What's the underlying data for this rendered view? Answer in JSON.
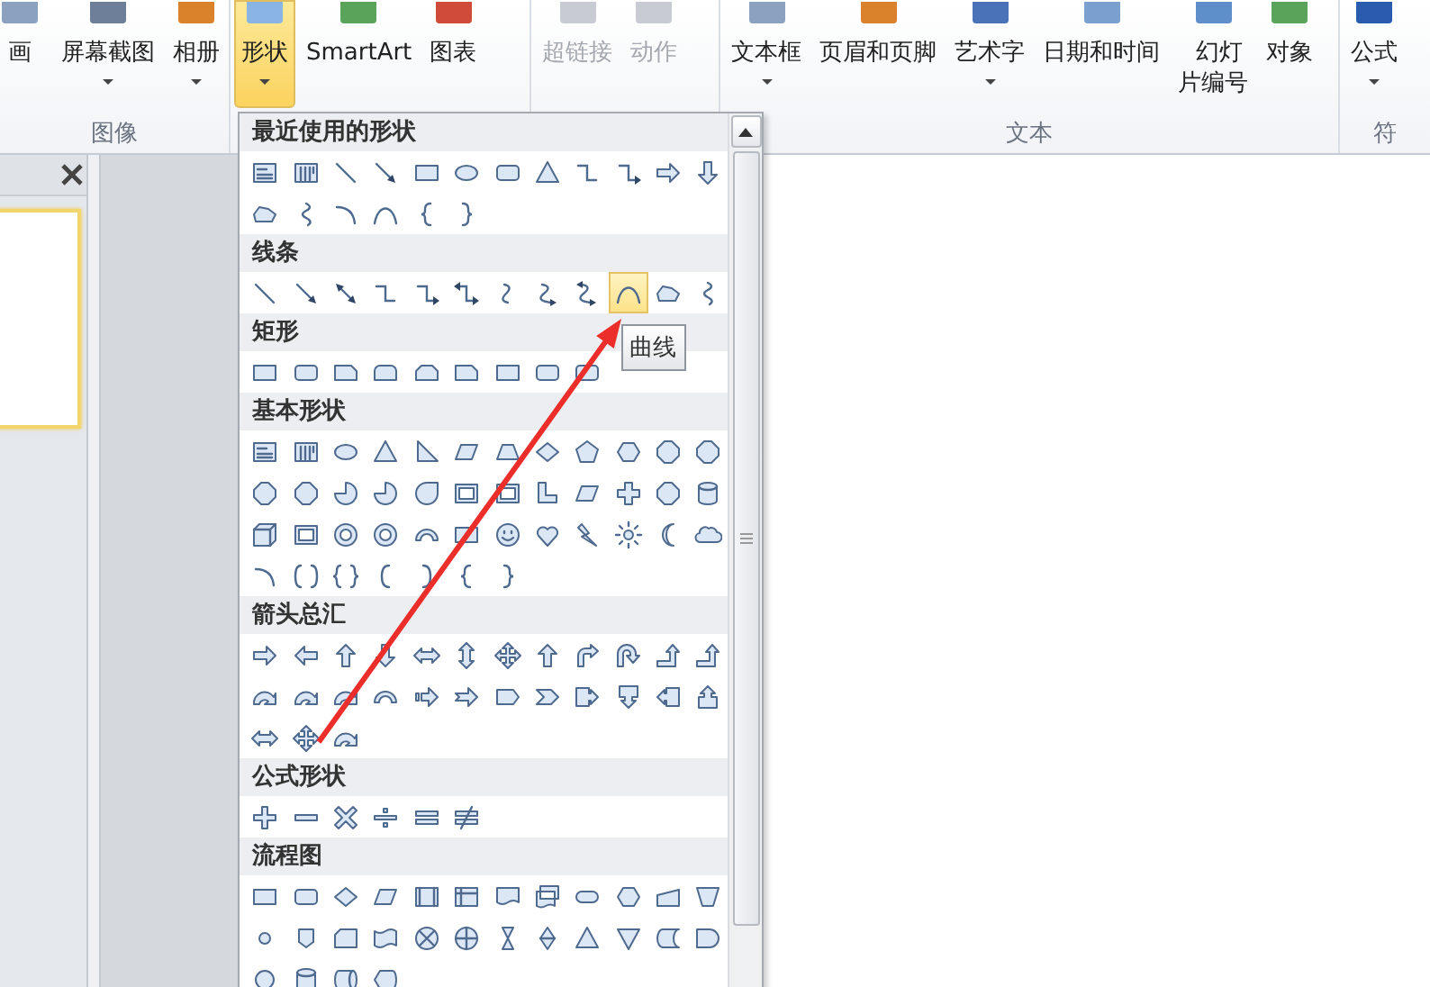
{
  "ribbon": {
    "groups": [
      {
        "label": "图像",
        "buttons": [
          {
            "label": "画",
            "dropdown": false,
            "disabled": false,
            "selected": false
          },
          {
            "label": "屏幕截图",
            "dropdown": true,
            "disabled": false,
            "selected": false
          },
          {
            "label": "相册",
            "dropdown": true,
            "disabled": false,
            "selected": false
          }
        ]
      },
      {
        "buttons": [
          {
            "label": "形状",
            "dropdown": true,
            "disabled": false,
            "selected": true
          },
          {
            "label": "SmartArt",
            "dropdown": false,
            "disabled": false,
            "selected": false
          },
          {
            "label": "图表",
            "dropdown": false,
            "disabled": false,
            "selected": false
          }
        ]
      },
      {
        "buttons": [
          {
            "label": "超链接",
            "dropdown": false,
            "disabled": true,
            "selected": false
          },
          {
            "label": "动作",
            "dropdown": false,
            "disabled": true,
            "selected": false
          }
        ]
      },
      {
        "label": "文本",
        "buttons": [
          {
            "label": "文本框",
            "dropdown": true,
            "disabled": false,
            "selected": false
          },
          {
            "label": "页眉和页脚",
            "dropdown": false,
            "disabled": false,
            "selected": false
          },
          {
            "label": "艺术字",
            "dropdown": true,
            "disabled": false,
            "selected": false
          },
          {
            "label": "日期和时间",
            "dropdown": false,
            "disabled": false,
            "selected": false
          },
          {
            "label": "幻灯片编号",
            "two_line": true,
            "dropdown": false,
            "disabled": false,
            "selected": false
          },
          {
            "label": "对象",
            "dropdown": false,
            "disabled": false,
            "selected": false
          }
        ]
      },
      {
        "label": "符",
        "buttons": [
          {
            "label": "公式",
            "dropdown": true,
            "disabled": false,
            "selected": false
          }
        ]
      }
    ]
  },
  "shapes_gallery": {
    "sections": [
      {
        "title": "最近使用的形状",
        "items": [
          {
            "kind": "textbox",
            "selected": false
          },
          {
            "kind": "vtextbox",
            "selected": false
          },
          {
            "kind": "line",
            "selected": false
          },
          {
            "kind": "arrow-line",
            "selected": false
          },
          {
            "kind": "rect",
            "selected": false
          },
          {
            "kind": "oval",
            "selected": false
          },
          {
            "kind": "roundrect",
            "selected": false
          },
          {
            "kind": "triangle",
            "selected": false
          },
          {
            "kind": "elbow",
            "selected": false
          },
          {
            "kind": "elbow-arrow",
            "selected": false
          },
          {
            "kind": "arrow-right",
            "selected": false
          },
          {
            "kind": "arrow-down",
            "selected": false
          },
          {
            "kind": "freeform",
            "selected": false
          },
          {
            "kind": "scribble",
            "selected": false
          },
          {
            "kind": "arc",
            "selected": false
          },
          {
            "kind": "curve",
            "selected": false
          },
          {
            "kind": "brace-left",
            "selected": false
          },
          {
            "kind": "brace-right",
            "selected": false
          }
        ]
      },
      {
        "title": "线条",
        "items": [
          {
            "kind": "line",
            "selected": false
          },
          {
            "kind": "arrow-line",
            "selected": false
          },
          {
            "kind": "double-arrow-line",
            "selected": false
          },
          {
            "kind": "elbow",
            "selected": false
          },
          {
            "kind": "elbow-arrow",
            "selected": false
          },
          {
            "kind": "elbow-double-arrow",
            "selected": false
          },
          {
            "kind": "curved-connector",
            "selected": false
          },
          {
            "kind": "curved-arrow-connector",
            "selected": false
          },
          {
            "kind": "curved-double-arrow",
            "selected": false
          },
          {
            "kind": "curve",
            "selected": true,
            "tooltip": "曲线"
          },
          {
            "kind": "freeform",
            "selected": false
          },
          {
            "kind": "scribble",
            "selected": false
          }
        ]
      },
      {
        "title": "矩形",
        "items": [
          {
            "kind": "rect",
            "selected": false
          },
          {
            "kind": "roundrect",
            "selected": false
          },
          {
            "kind": "snip",
            "selected": false
          },
          {
            "kind": "roundtop",
            "selected": false
          },
          {
            "kind": "snip-two",
            "selected": false
          },
          {
            "kind": "snip",
            "selected": false
          },
          {
            "kind": "rect",
            "selected": false
          },
          {
            "kind": "roundrect",
            "selected": false
          },
          {
            "kind": "roundrect",
            "selected": false
          }
        ]
      },
      {
        "title": "基本形状",
        "items": [
          {
            "kind": "textbox",
            "selected": false
          },
          {
            "kind": "vtextbox",
            "selected": false
          },
          {
            "kind": "oval",
            "selected": false
          },
          {
            "kind": "triangle",
            "selected": false
          },
          {
            "kind": "right-triangle",
            "selected": false
          },
          {
            "kind": "parallelogram",
            "selected": false
          },
          {
            "kind": "trapezoid",
            "selected": false
          },
          {
            "kind": "diamond",
            "selected": false
          },
          {
            "kind": "pentagon",
            "selected": false
          },
          {
            "kind": "hexagon",
            "selected": false
          },
          {
            "kind": "octagon",
            "selected": false
          },
          {
            "kind": "octagon",
            "selected": false
          },
          {
            "kind": "octagon",
            "selected": false
          },
          {
            "kind": "octagon",
            "selected": false
          },
          {
            "kind": "pie",
            "selected": false
          },
          {
            "kind": "pie",
            "selected": false
          },
          {
            "kind": "teardrop",
            "selected": false
          },
          {
            "kind": "frame",
            "selected": false
          },
          {
            "kind": "frame",
            "selected": false
          },
          {
            "kind": "lshape",
            "selected": false
          },
          {
            "kind": "parallelogram",
            "selected": false
          },
          {
            "kind": "cross",
            "selected": false
          },
          {
            "kind": "octagon",
            "selected": false
          },
          {
            "kind": "can",
            "selected": false
          },
          {
            "kind": "cube",
            "selected": false
          },
          {
            "kind": "frame",
            "selected": false
          },
          {
            "kind": "donut",
            "selected": false
          },
          {
            "kind": "donut",
            "selected": false
          },
          {
            "kind": "block-arc",
            "selected": false
          },
          {
            "kind": "rect",
            "selected": false
          },
          {
            "kind": "smiley",
            "selected": false
          },
          {
            "kind": "heart",
            "selected": false
          },
          {
            "kind": "lightning",
            "selected": false
          },
          {
            "kind": "sun",
            "selected": false
          },
          {
            "kind": "moon",
            "selected": false
          },
          {
            "kind": "cloud",
            "selected": false
          },
          {
            "kind": "arc",
            "selected": false
          },
          {
            "kind": "bracket-pair",
            "selected": false
          },
          {
            "kind": "brace-pair",
            "selected": false
          },
          {
            "kind": "bracket-left",
            "selected": false
          },
          {
            "kind": "bracket-right",
            "selected": false
          },
          {
            "kind": "brace-left",
            "selected": false
          },
          {
            "kind": "brace-right",
            "selected": false
          }
        ]
      },
      {
        "title": "箭头总汇",
        "items": [
          {
            "kind": "arrow-right",
            "selected": false
          },
          {
            "kind": "arrow-left",
            "selected": false
          },
          {
            "kind": "arrow-up",
            "selected": false
          },
          {
            "kind": "arrow-down",
            "selected": false
          },
          {
            "kind": "arrow-left-right",
            "selected": false
          },
          {
            "kind": "arrow-up-down",
            "selected": false
          },
          {
            "kind": "quad-arrow",
            "selected": false
          },
          {
            "kind": "arrow-up",
            "selected": false
          },
          {
            "kind": "bent-arrow",
            "selected": false
          },
          {
            "kind": "uturn-arrow",
            "selected": false
          },
          {
            "kind": "bent-up-arrow",
            "selected": false
          },
          {
            "kind": "bent-up-arrow",
            "selected": false
          },
          {
            "kind": "circular-arrow",
            "selected": false
          },
          {
            "kind": "circular-arrow",
            "selected": false
          },
          {
            "kind": "circular-arrow",
            "selected": false
          },
          {
            "kind": "block-arc",
            "selected": false
          },
          {
            "kind": "striped-arrow",
            "selected": false
          },
          {
            "kind": "notched-arrow",
            "selected": false
          },
          {
            "kind": "homeplate",
            "selected": false
          },
          {
            "kind": "chevron",
            "selected": false
          },
          {
            "kind": "callout-right",
            "selected": false
          },
          {
            "kind": "callout-down",
            "selected": false
          },
          {
            "kind": "callout-left",
            "selected": false
          },
          {
            "kind": "callout-up",
            "selected": false
          },
          {
            "kind": "arrow-left-right",
            "selected": false
          },
          {
            "kind": "quad-arrow",
            "selected": false
          },
          {
            "kind": "circular-arrow",
            "selected": false
          }
        ]
      },
      {
        "title": "公式形状",
        "items": [
          {
            "kind": "plus",
            "selected": false
          },
          {
            "kind": "minus",
            "selected": false
          },
          {
            "kind": "multiply",
            "selected": false
          },
          {
            "kind": "divide",
            "selected": false
          },
          {
            "kind": "equal",
            "selected": false
          },
          {
            "kind": "not-equal",
            "selected": false
          }
        ]
      },
      {
        "title": "流程图",
        "items": [
          {
            "kind": "rect",
            "selected": false
          },
          {
            "kind": "roundrect",
            "selected": false
          },
          {
            "kind": "diamond",
            "selected": false
          },
          {
            "kind": "parallelogram",
            "selected": false
          },
          {
            "kind": "predefined",
            "selected": false
          },
          {
            "kind": "internal-storage",
            "selected": false
          },
          {
            "kind": "document",
            "selected": false
          },
          {
            "kind": "multidocument",
            "selected": false
          },
          {
            "kind": "terminator",
            "selected": false
          },
          {
            "kind": "hexagon",
            "selected": false
          },
          {
            "kind": "manual-input",
            "selected": false
          },
          {
            "kind": "manual-operation",
            "selected": false
          },
          {
            "kind": "small-circle",
            "selected": false
          },
          {
            "kind": "offpage",
            "selected": false
          },
          {
            "kind": "card",
            "selected": false
          },
          {
            "kind": "punched-tape",
            "selected": false
          },
          {
            "kind": "summing",
            "selected": false
          },
          {
            "kind": "or",
            "selected": false
          },
          {
            "kind": "collate",
            "selected": false
          },
          {
            "kind": "sort",
            "selected": false
          },
          {
            "kind": "triangle",
            "selected": false
          },
          {
            "kind": "inv-triangle",
            "selected": false
          },
          {
            "kind": "stored-data",
            "selected": false
          },
          {
            "kind": "delay",
            "selected": false
          },
          {
            "kind": "circle",
            "selected": false
          },
          {
            "kind": "can",
            "selected": false
          },
          {
            "kind": "direct-access",
            "selected": false
          },
          {
            "kind": "display",
            "selected": false
          }
        ]
      }
    ]
  }
}
